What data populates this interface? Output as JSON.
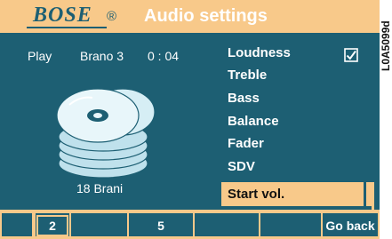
{
  "header": {
    "brand": "BOSE",
    "registered": "®",
    "title": "Audio settings"
  },
  "status": {
    "mode": "Play",
    "track": "Brano 3",
    "time": "0 : 04",
    "track_count": "18 Brani"
  },
  "menu": {
    "items": [
      {
        "label": "Loudness",
        "checked": true
      },
      {
        "label": "Treble"
      },
      {
        "label": "Bass"
      },
      {
        "label": "Balance"
      },
      {
        "label": "Fader"
      },
      {
        "label": "SDV"
      },
      {
        "label": "Start vol."
      }
    ],
    "selected_index": 6
  },
  "footer": {
    "buttons": [
      "2",
      "",
      "5",
      "",
      "",
      "Go back"
    ]
  },
  "image_code": "L0A5099d",
  "colors": {
    "screen": "#1d5f73",
    "accent": "#f8c98a",
    "text": "#ffffff"
  }
}
